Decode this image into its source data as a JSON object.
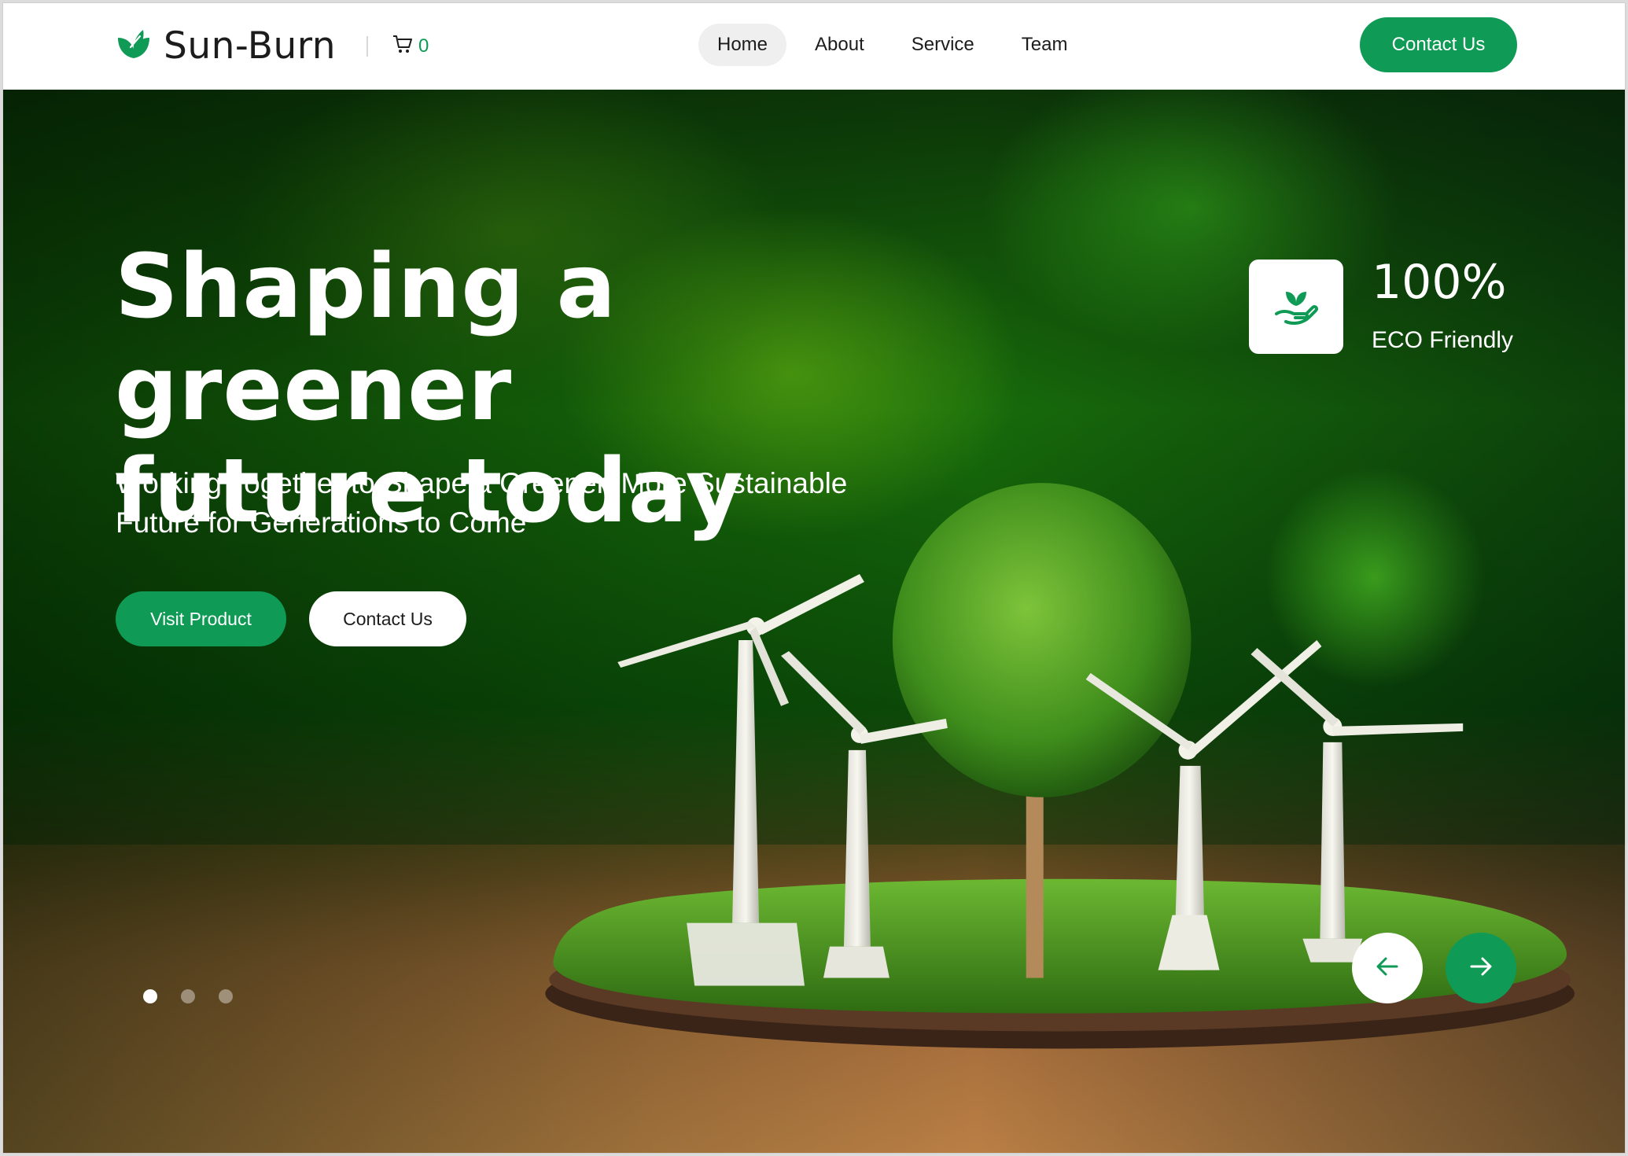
{
  "header": {
    "brand": "Sun-Burn",
    "cart_count": "0",
    "nav": [
      {
        "label": "Home",
        "active": true
      },
      {
        "label": "About",
        "active": false
      },
      {
        "label": "Service",
        "active": false
      },
      {
        "label": "Team",
        "active": false
      }
    ],
    "cta_label": "Contact Us"
  },
  "hero": {
    "title_line1": "Shaping a greener",
    "title_line2": "future today",
    "subtitle_line1": "Working Together to Shape a Greener, More Sustainable",
    "subtitle_line2": "Future for Generations to Come",
    "primary_button": "Visit Product",
    "secondary_button": "Contact Us",
    "stat": {
      "value": "100%",
      "label": "ECO Friendly",
      "icon": "plant-in-hand-icon"
    },
    "slider": {
      "slide_count": 3,
      "active_index": 0
    }
  },
  "icons": {
    "logo": "leaf-icon",
    "cart": "cart-icon",
    "prev": "arrow-left-icon",
    "next": "arrow-right-icon"
  },
  "colors": {
    "accent": "#0f9a55",
    "text_dark": "#1c1c1c",
    "nav_active_bg": "#efefef"
  }
}
